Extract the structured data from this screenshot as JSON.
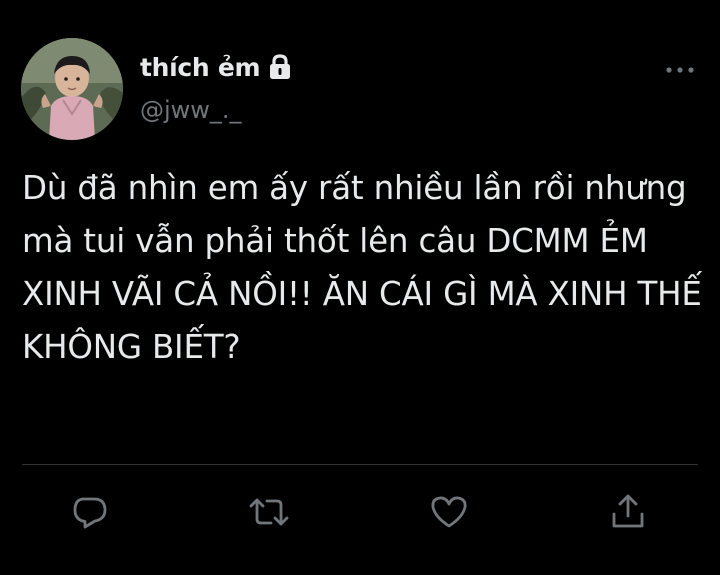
{
  "colors": {
    "background": "#000000",
    "text_primary": "#e7e9ea",
    "text_secondary": "#71767b",
    "divider": "#2f3336"
  },
  "author": {
    "display_name": "thích ẻm",
    "handle": "@jww_._",
    "protected": true,
    "avatar_icon": "avatar-photo"
  },
  "tweet": {
    "text": "Dù đã nhìn em ấy rất nhiều lần rồi nhưng\nmà tui vẫn phải thốt lên câu DCMM ẺM\nXINH VÃI CẢ NỒI!! ĂN CÁI GÌ MÀ XINH THẾ\nKHÔNG BIẾT?"
  },
  "icons": {
    "lock": "lock-icon",
    "more": "more-horizontal-icon",
    "reply": "reply-icon",
    "retweet": "retweet-icon",
    "like": "heart-icon",
    "share": "share-icon"
  }
}
